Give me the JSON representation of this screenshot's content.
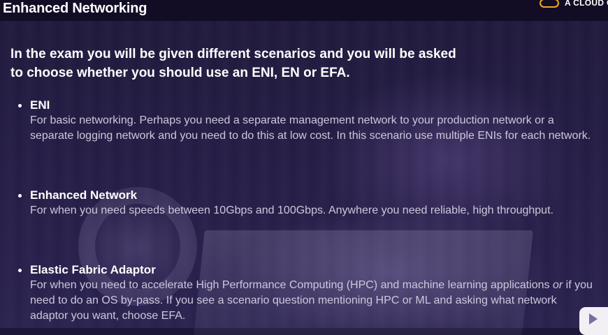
{
  "header": {
    "title": "Enhanced Networking",
    "brand_text": "A CLOUD GURU",
    "brand_color": "#f5a623"
  },
  "intro": {
    "line1": "In the exam you will be given different scenarios and you will be asked",
    "line2": "to choose whether you should use an ENI, EN or EFA."
  },
  "bullets": [
    {
      "title": "ENI",
      "body": "For basic networking. Perhaps you need a separate management network to your production network or a separate logging network and you need to do this at low cost. In this scenario use multiple ENIs for each network."
    },
    {
      "title": "Enhanced Network",
      "body": "For when you need speeds between 10Gbps and 100Gbps. Anywhere you need reliable, high throughput."
    },
    {
      "title": "Elastic Fabric Adaptor",
      "body_part1": "For when you need to accelerate High Performance Computing (HPC) and machine learning applications ",
      "body_emph": "or",
      "body_part2": " if you need to do an OS by-pass. If you see a scenario question mentioning HPC or ML and asking what network adaptor you want, choose EFA."
    }
  ],
  "icons": {
    "brand_logo": "cloud-logo-icon",
    "play": "play-icon"
  }
}
